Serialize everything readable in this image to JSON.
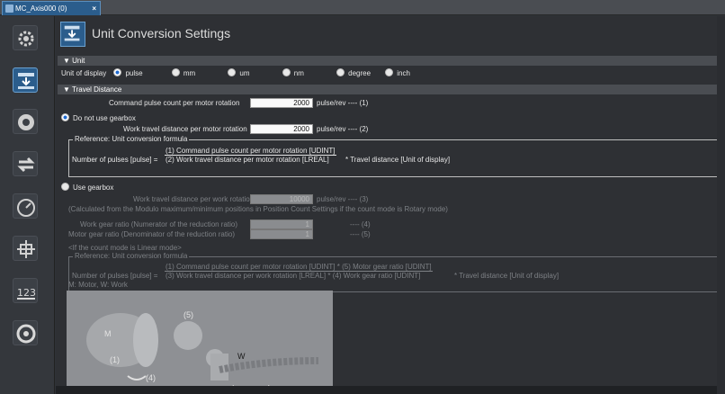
{
  "tab": {
    "title": "MC_Axis000 (0)",
    "close": "×"
  },
  "header": {
    "title": "Unit Conversion Settings"
  },
  "unit_section": {
    "label": "▼ Unit",
    "display_label": "Unit of display",
    "options": [
      "pulse",
      "mm",
      "um",
      "nm",
      "degree",
      "inch"
    ],
    "selected": "pulse"
  },
  "travel_section": {
    "label": "▼ Travel Distance",
    "cmd_pulse_label": "Command pulse count per motor rotation",
    "cmd_pulse_value": "2000",
    "cmd_pulse_unit": "pulse/rev ---- (1)"
  },
  "no_gearbox": {
    "label": "Do not use gearbox",
    "work_travel_label": "Work travel distance per motor rotation",
    "work_travel_value": "2000",
    "work_travel_unit": "pulse/rev ---- (2)",
    "ref_title": "Reference: Unit conversion formula",
    "formula_prefix": "Number of pulses [pulse] =",
    "numerator": "(1) Command pulse count per motor rotation [UDINT]",
    "denominator": "(2) Work travel distance per motor rotation [LREAL]",
    "formula_suffix": "* Travel distance [Unit of display]"
  },
  "gearbox": {
    "label": "Use gearbox",
    "work_rot_label": "Work travel distance per work rotation",
    "work_rot_value": "10000",
    "work_rot_unit": "pulse/rev ---- (3)",
    "calc_note": "(Calculated from the Modulo maximum/minimum positions in Position Count Settings if the count mode is Rotary mode)",
    "num_label": "Work gear ratio (Numerator of the reduction ratio)",
    "num_value": "1",
    "num_unit": "---- (4)",
    "den_label": "Motor gear ratio (Denominator of the reduction ratio)",
    "den_value": "1",
    "den_unit": "---- (5)",
    "linear_note": "<If the count mode is Linear mode>",
    "ref_title": "Reference: Unit conversion formula",
    "formula_prefix": "Number of pulses [pulse] =",
    "numerator": "(1) Command pulse count per motor rotation [UDINT] * (5) Motor gear ratio [UDINT]",
    "denominator": "(3) Work travel distance per work rotation [LREAL] * (4) Work gear ratio [UDINT]",
    "formula_suffix": "* Travel distance [Unit of display]",
    "legend_note": "M: Motor, W: Work",
    "img_labels": {
      "m": "M",
      "w": "W",
      "l1": "(1)",
      "l4": "(4)",
      "l5": "(5)"
    }
  }
}
